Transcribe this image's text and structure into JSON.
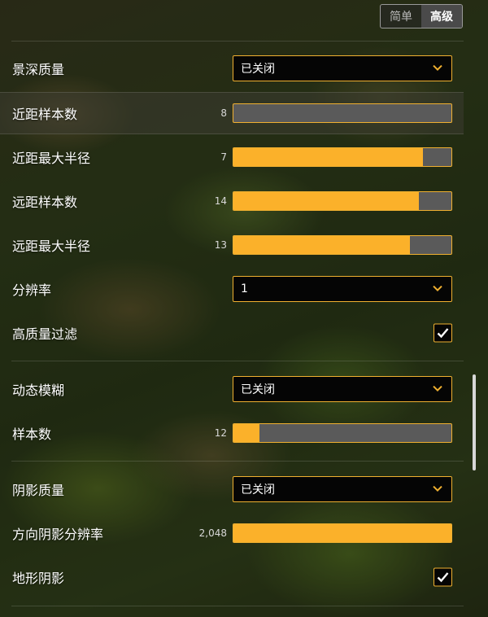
{
  "mode_switch": {
    "simple_label": "简单",
    "advanced_label": "高级",
    "active": "advanced"
  },
  "settings": {
    "dof_quality": {
      "label": "景深质量",
      "value": "已关闭"
    },
    "near_samples": {
      "label": "近距样本数",
      "value": "8",
      "fill": 0.0
    },
    "near_max_radius": {
      "label": "近距最大半径",
      "value": "7",
      "fill": 0.87
    },
    "far_samples": {
      "label": "远距样本数",
      "value": "14",
      "fill": 0.85
    },
    "far_max_radius": {
      "label": "远距最大半径",
      "value": "13",
      "fill": 0.81
    },
    "resolution": {
      "label": "分辨率",
      "value": "1"
    },
    "hq_filter": {
      "label": "高质量过滤",
      "checked": true
    },
    "motion_blur": {
      "label": "动态模糊",
      "value": "已关闭"
    },
    "sample_count": {
      "label": "样本数",
      "value": "12",
      "fill": 0.12
    },
    "shadow_quality": {
      "label": "阴影质量",
      "value": "已关闭"
    },
    "dir_shadow_res": {
      "label": "方向阴影分辨率",
      "value": "2,048",
      "fill": 1.0
    },
    "terrain_shadows": {
      "label": "地形阴影",
      "checked": true
    }
  },
  "colors": {
    "accent": "#fbb12a",
    "track": "#5a5a5a",
    "control_bg": "#050505"
  },
  "icons": {
    "dropdown": "chevron-down-icon",
    "checkbox": "checkmark-icon"
  }
}
